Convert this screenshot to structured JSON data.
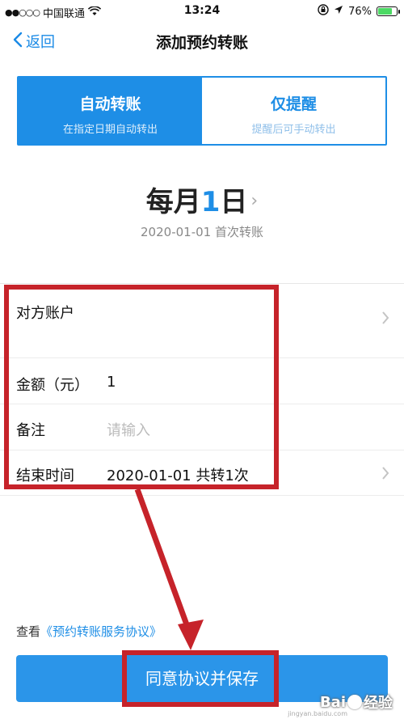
{
  "status_bar": {
    "signal_dots": "●●○○○",
    "carrier": "中国联通",
    "wifi_icon": "wifi-icon",
    "time": "13:24",
    "rotation_lock_icon": "rotation-lock-icon",
    "location_icon": "location-arrow-icon",
    "battery_percent": "76%",
    "battery_level": 0.76
  },
  "nav": {
    "back_label": "返回",
    "title": "添加预约转账"
  },
  "segments": [
    {
      "title": "自动转账",
      "subtitle": "在指定日期自动转出",
      "active": true
    },
    {
      "title": "仅提醒",
      "subtitle": "提醒后可手动转出",
      "active": false
    }
  ],
  "schedule": {
    "prefix": "每月",
    "day": "1",
    "suffix": "日",
    "first_transfer": "2020-01-01 首次转账"
  },
  "form": {
    "account_label": "对方账户",
    "account_value": "",
    "amount_label": "金额（元）",
    "amount_value": "1",
    "note_label": "备注",
    "note_placeholder": "请输入",
    "end_label": "结束时间",
    "end_value": "2020-01-01 共转1次"
  },
  "agreement": {
    "prefix": "查看",
    "link": "《预约转账服务协议》"
  },
  "save_button": "同意协议并保存",
  "watermark": {
    "text": "Bai",
    "text2": "经验",
    "url": "jingyan.baidu.com"
  },
  "colors": {
    "accent": "#1e8ee6",
    "annotation_red": "#c6232a"
  }
}
